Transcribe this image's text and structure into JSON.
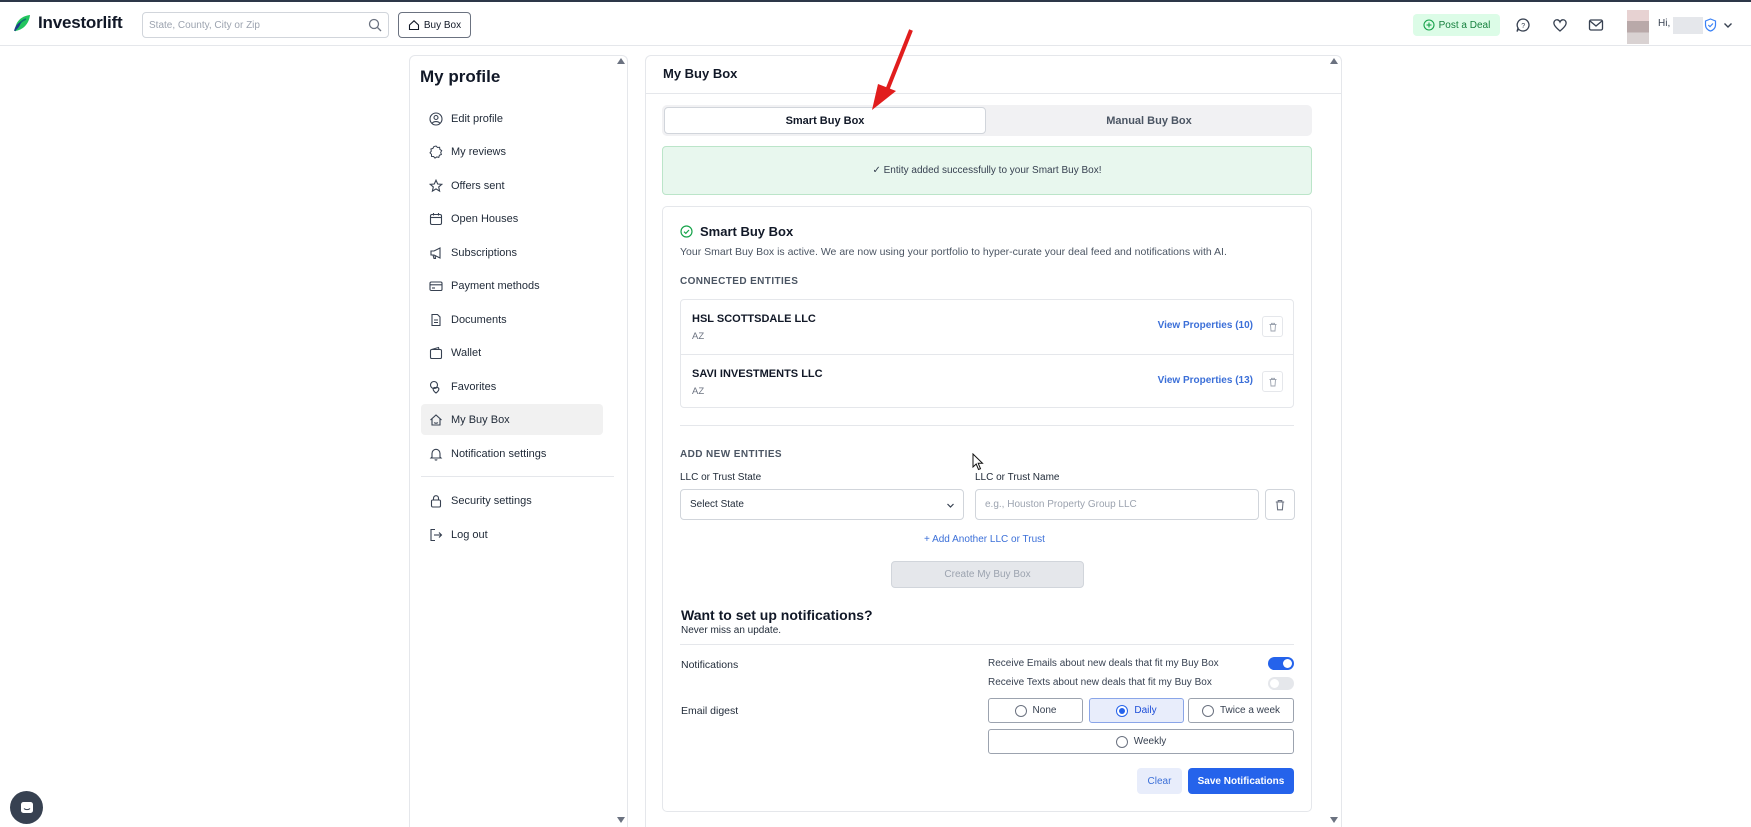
{
  "header": {
    "logo_text": "Investorlift",
    "search_placeholder": "State, County, City or Zip",
    "buybox_label": "Buy Box",
    "post_deal_label": "Post a Deal",
    "greeting": "Hi,"
  },
  "sidebar": {
    "title": "My profile",
    "items": [
      {
        "label": "Edit profile",
        "icon": "user-circle-icon"
      },
      {
        "label": "My reviews",
        "icon": "badge-icon"
      },
      {
        "label": "Offers sent",
        "icon": "star-icon"
      },
      {
        "label": "Open Houses",
        "icon": "calendar-icon"
      },
      {
        "label": "Subscriptions",
        "icon": "megaphone-icon"
      },
      {
        "label": "Payment methods",
        "icon": "credit-card-icon"
      },
      {
        "label": "Documents",
        "icon": "document-icon"
      },
      {
        "label": "Wallet",
        "icon": "wallet-icon"
      },
      {
        "label": "Favorites",
        "icon": "favorites-icon"
      },
      {
        "label": "My Buy Box",
        "icon": "house-icon",
        "active": true
      },
      {
        "label": "Notification settings",
        "icon": "bell-icon"
      }
    ],
    "bottom_items": [
      {
        "label": "Security settings",
        "icon": "lock-icon"
      },
      {
        "label": "Log out",
        "icon": "logout-icon"
      }
    ]
  },
  "main": {
    "title": "My Buy Box",
    "tabs": [
      {
        "label": "Smart Buy Box",
        "active": true
      },
      {
        "label": "Manual Buy Box",
        "active": false
      }
    ],
    "success_message": "✓  Entity added successfully to your Smart Buy Box!",
    "smart": {
      "heading": "Smart Buy Box",
      "description": "Your Smart Buy Box is active. We are now using your portfolio to hyper-curate your deal feed and notifications with AI.",
      "connected_label": "CONNECTED ENTITIES",
      "entities": [
        {
          "name": "HSL SCOTTSDALE LLC",
          "state": "AZ",
          "link": "View Properties (10)"
        },
        {
          "name": "SAVI INVESTMENTS LLC",
          "state": "AZ",
          "link": "View Properties (13)"
        }
      ],
      "add_label": "ADD NEW ENTITIES",
      "state_label": "LLC or Trust State",
      "state_value": "Select State",
      "name_label": "LLC or Trust Name",
      "name_placeholder": "e.g., Houston Property Group LLC",
      "add_another": "+ Add Another LLC or Trust",
      "create_label": "Create My Buy Box"
    },
    "notifications": {
      "title": "Want to set up notifications?",
      "subtitle": "Never miss an update.",
      "notifications_label": "Notifications",
      "email_pref": "Receive Emails about new deals that fit my Buy Box",
      "text_pref": "Receive Texts about new deals that fit my Buy Box",
      "email_on": true,
      "text_on": false,
      "digest_label": "Email digest",
      "digest_options": [
        "None",
        "Daily",
        "Twice a week",
        "Weekly"
      ],
      "digest_selected": "Daily",
      "clear_label": "Clear",
      "save_label": "Save Notifications"
    }
  },
  "colors": {
    "brand_green": "#22c55e",
    "accent_blue": "#2563eb",
    "success_bg": "#e8f7ee",
    "arrow_red": "#e11d1d"
  }
}
